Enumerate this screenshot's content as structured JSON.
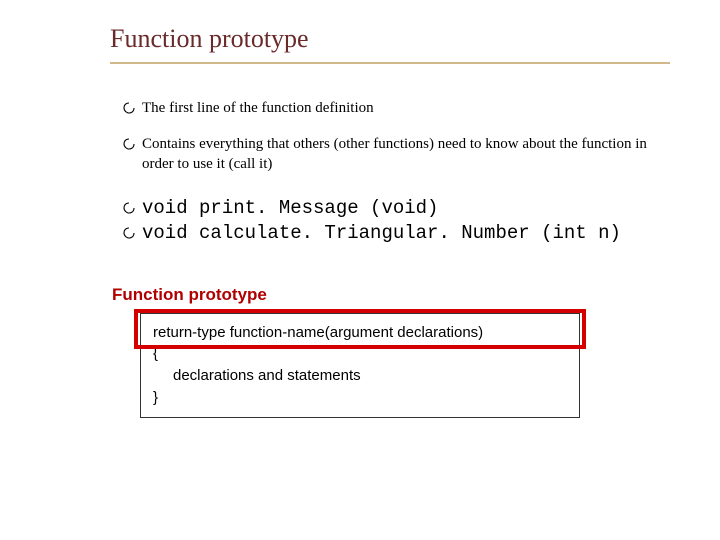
{
  "title": "Function prototype",
  "bullets": [
    {
      "text": "The first line of the function definition"
    },
    {
      "text": "Contains everything that others (other functions) need to know about the function in order to use it (call it)"
    }
  ],
  "code": [
    "void print. Message (void)",
    "void calculate. Triangular. Number (int n)"
  ],
  "sublabel": "Function prototype",
  "syntax": {
    "line1": "return-type  function-name(argument declarations)",
    "brace_open": "{",
    "line2": "declarations  and statements",
    "brace_close": "}"
  }
}
